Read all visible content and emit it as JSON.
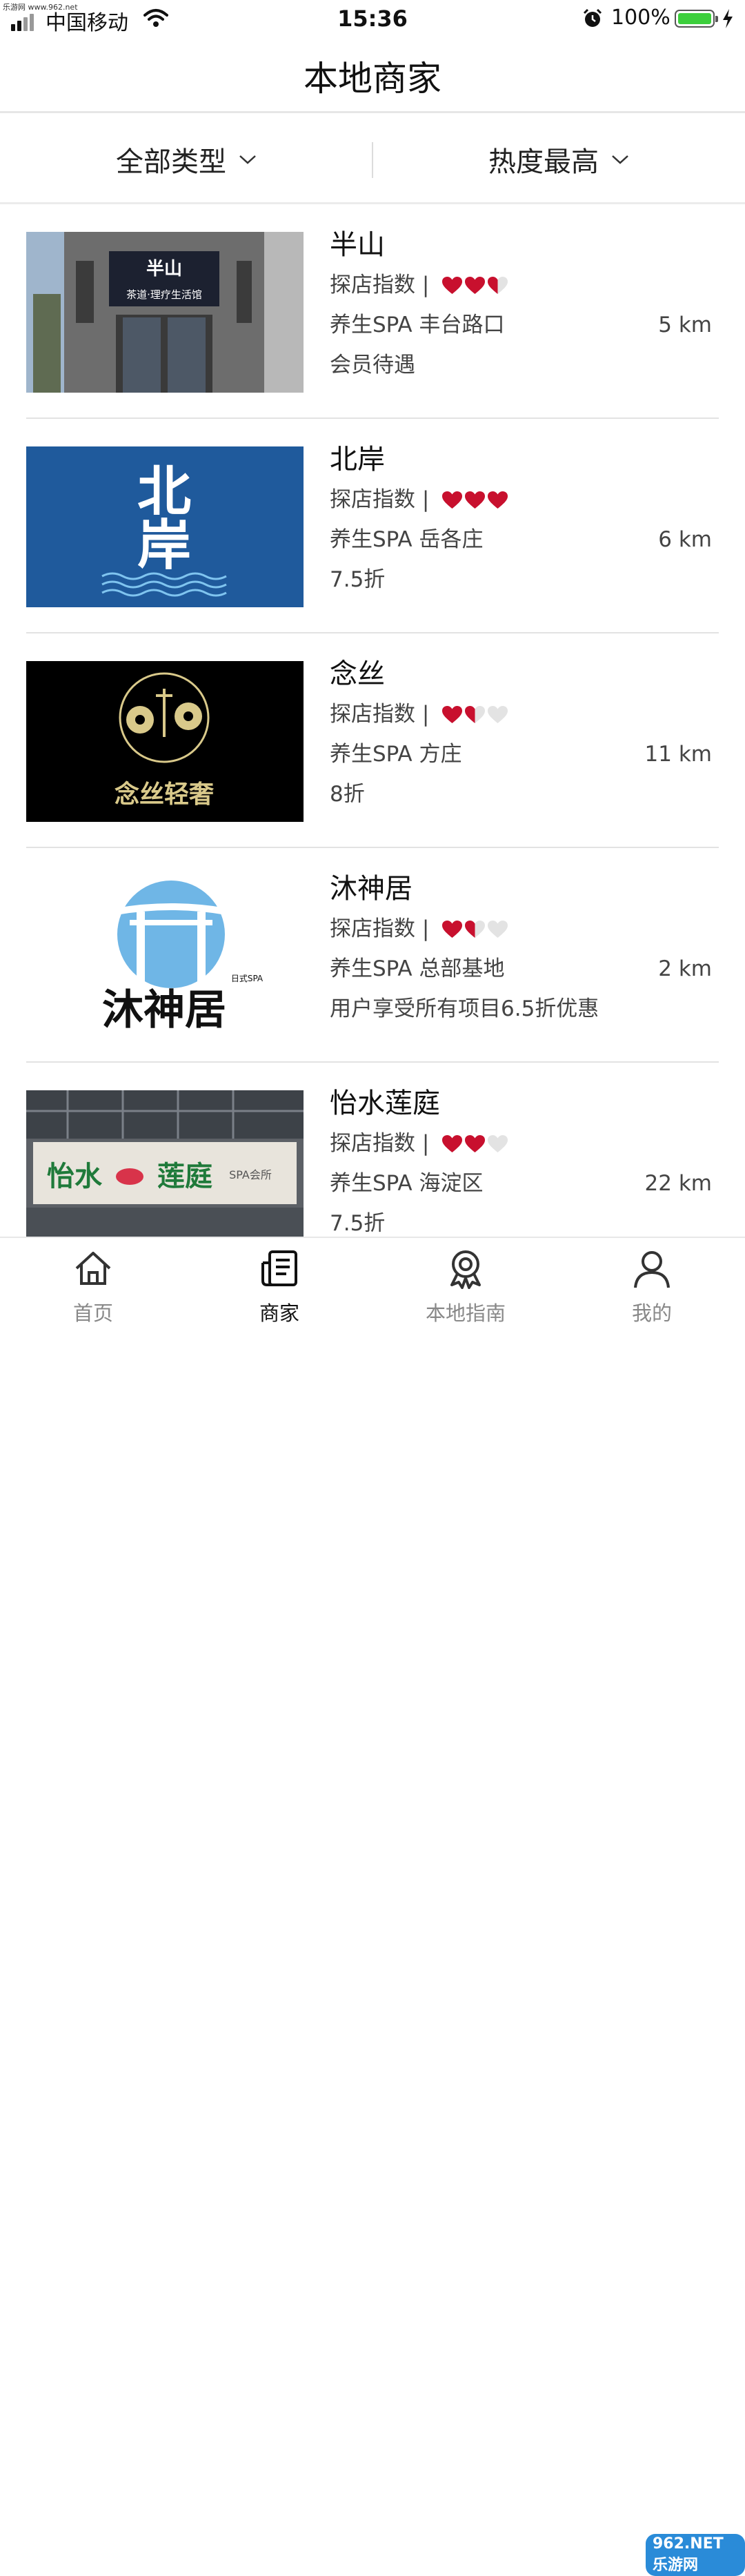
{
  "status_bar": {
    "watermark": "乐游网 www.962.net",
    "carrier": "中国移动",
    "time": "15:36",
    "battery_text": "100%",
    "battery_level": 1.0
  },
  "header": {
    "title": "本地商家"
  },
  "filters": [
    {
      "label": "全部类型",
      "icon": "chevron-down-icon"
    },
    {
      "label": "热度最高",
      "icon": "chevron-down-icon"
    }
  ],
  "score_label": "探店指数 |",
  "merchants": [
    {
      "name": "半山",
      "rating": 2.5,
      "category_location": "养生SPA 丰台路口",
      "distance": "5 km",
      "promo": "会员待遇",
      "image_text": [
        "半山",
        "茶道·理疗生活馆"
      ]
    },
    {
      "name": "北岸",
      "rating": 3,
      "category_location": "养生SPA 岳各庄",
      "distance": "6 km",
      "promo": "7.5折",
      "image_text": [
        "北",
        "岸"
      ]
    },
    {
      "name": "念丝",
      "rating": 1.5,
      "category_location": "养生SPA 方庄",
      "distance": "11 km",
      "promo": "8折",
      "image_text": [
        "念丝轻奢"
      ]
    },
    {
      "name": "沐神居",
      "rating": 1.5,
      "category_location": "养生SPA 总部基地",
      "distance": "2 km",
      "promo": "用户享受所有项目6.5折优惠",
      "image_text": [
        "沐神居",
        "日式SPA"
      ]
    },
    {
      "name": "怡水莲庭",
      "rating": 2,
      "category_location": "养生SPA 海淀区",
      "distance": "22 km",
      "promo": "7.5折",
      "image_text": [
        "怡水",
        "莲庭",
        "SPA会所"
      ]
    }
  ],
  "tabs": [
    {
      "label": "首页",
      "icon": "home-icon",
      "active": false
    },
    {
      "label": "商家",
      "icon": "merchant-list-icon",
      "active": true
    },
    {
      "label": "本地指南",
      "icon": "award-icon",
      "active": false
    },
    {
      "label": "我的",
      "icon": "user-icon",
      "active": false
    }
  ],
  "footer_watermark": "962.NET 乐游网",
  "colors": {
    "heart": "#c8102e",
    "heart_empty": "#e3e3e3",
    "active_tab": "#111111",
    "inactive_tab": "#888888",
    "battery": "#3ccf3c"
  }
}
